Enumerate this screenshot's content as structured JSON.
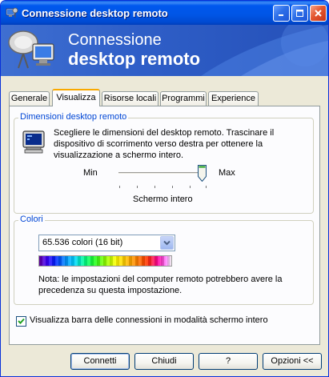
{
  "window": {
    "title": "Connessione desktop remoto"
  },
  "banner": {
    "line1": "Connessione",
    "line2": "desktop remoto"
  },
  "tabs": [
    {
      "label": "Generale",
      "active": false
    },
    {
      "label": "Visualizza",
      "active": true
    },
    {
      "label": "Risorse locali",
      "active": false
    },
    {
      "label": "Programmi",
      "active": false
    },
    {
      "label": "Experience",
      "active": false
    }
  ],
  "display_size": {
    "group_label": "Dimensioni desktop remoto",
    "description": "Scegliere le dimensioni del desktop remoto. Trascinare il dispositivo di scorrimento verso destra per ottenere la visualizzazione a schermo intero.",
    "min_label": "Min",
    "max_label": "Max",
    "slider_value": 1.0,
    "current_value": "Schermo intero"
  },
  "colors": {
    "group_label": "Colori",
    "selected": "65.536 colori (16 bit)",
    "note": "Nota: le impostazioni del computer remoto potrebbero avere la precedenza su questa impostazione."
  },
  "connection_bar": {
    "checked": true,
    "label": "Visualizza barra delle connessioni in modalità schermo intero"
  },
  "buttons": {
    "connect": "Connetti",
    "close": "Chiudi",
    "help": "?",
    "options": "Opzioni <<"
  },
  "colors_theme": {
    "titlebar": "#0055e5",
    "group_label": "#0046d5",
    "active_tab_accent": "#f9a900"
  },
  "icons": {
    "title": "remote-desktop-icon",
    "banner": "remote-desktop-logo-icon",
    "display": "monitor-icon"
  }
}
